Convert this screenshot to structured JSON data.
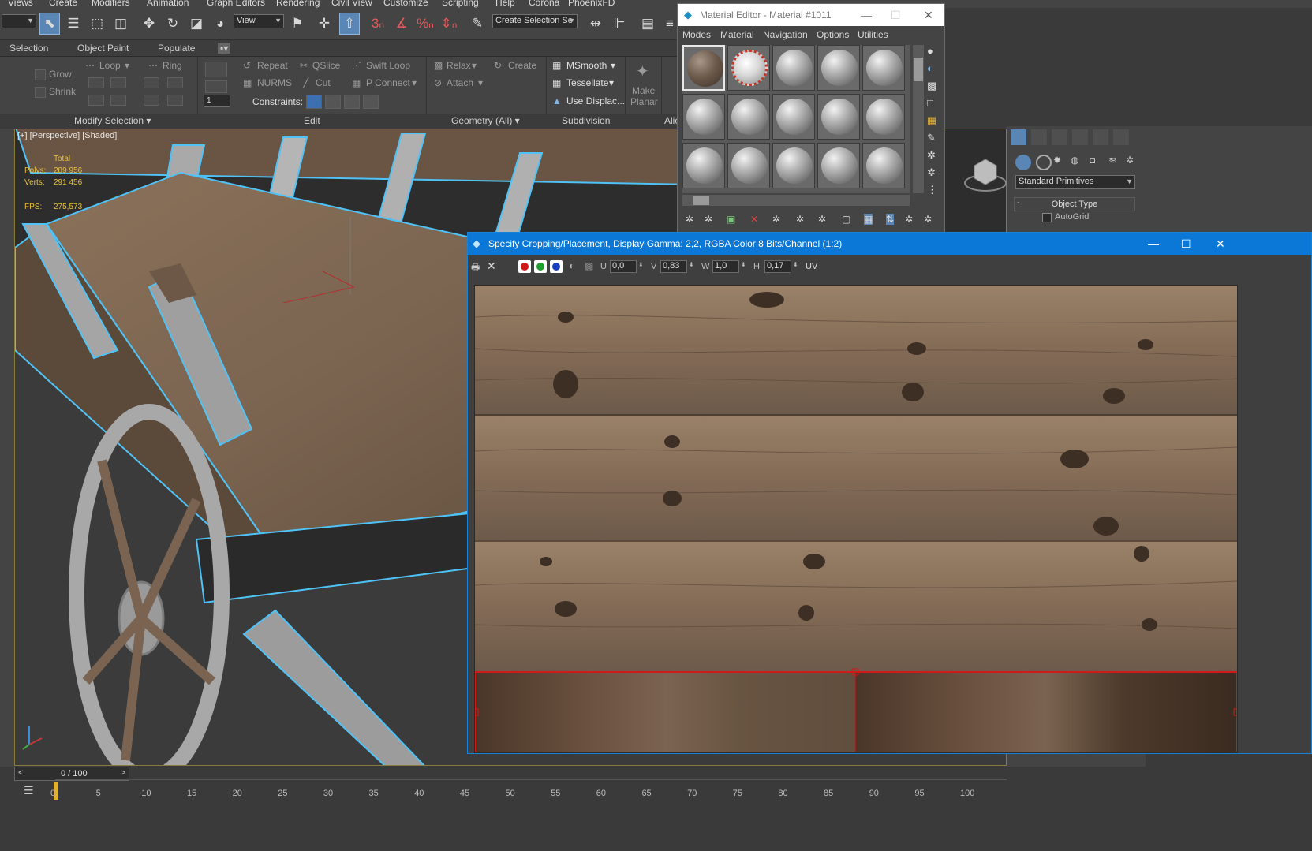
{
  "menubar": [
    "Views",
    "Create",
    "Modifiers",
    "Animation",
    "Graph Editors",
    "Rendering",
    "Civil View",
    "Customize",
    "Scripting",
    "Help",
    "Corona",
    "PhoenixFD"
  ],
  "toolbar": {
    "view_combo": "View",
    "selection_set_placeholder": "Create Selection Se"
  },
  "ribbon": {
    "tabs": [
      "Selection",
      "Object Paint",
      "Populate"
    ],
    "modify_selection": {
      "grow": "Grow",
      "shrink": "Shrink",
      "loop": "Loop",
      "ring": "Ring",
      "footer": "Modify Selection ▾"
    },
    "edit": {
      "repeat": "Repeat",
      "qslice": "QSlice",
      "swift_loop": "Swift Loop",
      "nurms": "NURMS",
      "cut": "Cut",
      "p_connect": "P Connect",
      "constraints": "Constraints:",
      "spinner_value": "1",
      "footer": "Edit"
    },
    "geometry": {
      "relax": "Relax",
      "create": "Create",
      "attach": "Attach",
      "footer": "Geometry (All) ▾"
    },
    "subdivision": {
      "msmooth": "MSmooth",
      "tessellate": "Tessellate",
      "use_displace": "Use Displac...",
      "make_planar_1": "Make",
      "make_planar_2": "Planar",
      "footer": "Subdivision"
    },
    "align_footer": "Alic"
  },
  "viewport": {
    "label": "[+] [Perspective] [Shaded]",
    "stats": {
      "total_label": "Total",
      "polys_label": "Polys:",
      "polys_value": "289 956",
      "verts_label": "Verts:",
      "verts_value": "291 456",
      "fps_label": "FPS:",
      "fps_value": "275,573"
    }
  },
  "material_editor": {
    "title": "Material Editor - Material #1011",
    "menu": [
      "Modes",
      "Material",
      "Navigation",
      "Options",
      "Utilities"
    ]
  },
  "command_panel": {
    "dropdown": "Standard Primitives",
    "rollout_title": "Object Type",
    "autogrid": "AutoGrid"
  },
  "crop_window": {
    "title": "Specify Cropping/Placement, Display Gamma: 2,2, RGBA Color 8 Bits/Channel (1:2)",
    "u_label": "U",
    "u_value": "0,0",
    "v_label": "V",
    "v_value": "0,83",
    "w_label": "W",
    "w_value": "1,0",
    "h_label": "H",
    "h_value": "0,17",
    "uv_label": "UV"
  },
  "timeline": {
    "frame": "0 / 100",
    "ticks": [
      "0",
      "5",
      "10",
      "15",
      "20",
      "25",
      "30",
      "35",
      "40",
      "45",
      "50",
      "55",
      "60",
      "65",
      "70",
      "75",
      "80",
      "85",
      "90",
      "95",
      "100"
    ]
  },
  "colors": {
    "accent": "#0b78d7",
    "viewport_highlight": "#4fc3f7",
    "stats_yellow": "#e8c23a",
    "crop_red": "#d01a1a"
  }
}
